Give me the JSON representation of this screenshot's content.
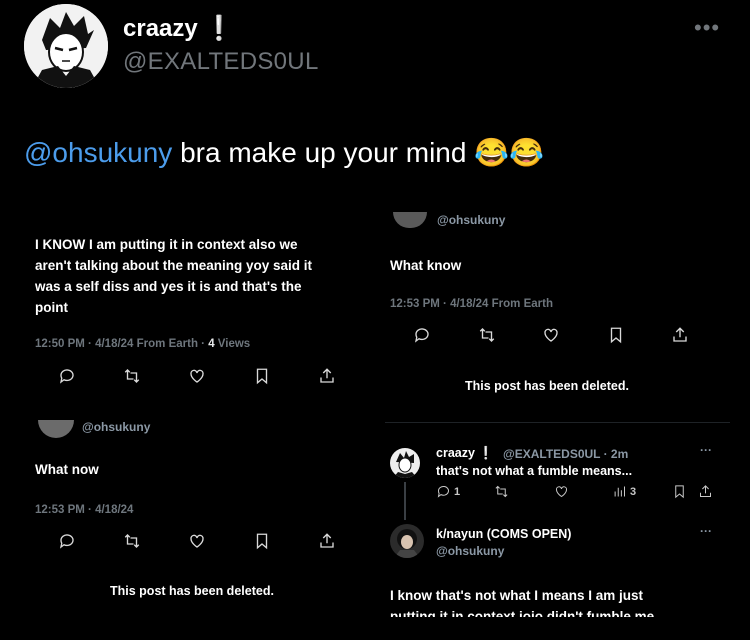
{
  "profile": {
    "name": "craazy",
    "badge": "❕",
    "handle": "@EXALTEDS0UL",
    "more_icon": "more-icon"
  },
  "tweet": {
    "mention": "@ohsukuny",
    "text": "bra make up your mind",
    "emoji": "😂😂"
  },
  "left": {
    "post1": {
      "text": "I KNOW I am putting it in context also we aren't talking about the meaning yoy said it was a self diss and yes it is and that's the point",
      "meta_prefix": "12:50 PM · 4/18/24 From Earth · ",
      "views_count": "4",
      "views_label": " Views"
    },
    "post2": {
      "handle": "@ohsukuny",
      "text": "What now",
      "meta": "12:53 PM · 4/18/24"
    },
    "deleted": "This post has been deleted."
  },
  "right": {
    "post1": {
      "handle": "@ohsukuny",
      "text": "What know",
      "meta": "12:53 PM · 4/18/24 From Earth"
    },
    "deleted": "This post has been deleted.",
    "reply1": {
      "name": "craazy",
      "badge": "❕",
      "handle_time": "@EXALTEDS0UL · 2m",
      "text": "that's not what a fumble means...",
      "reply_count": "1",
      "views_count": "3"
    },
    "reply2": {
      "name": "k/nayun (COMS OPEN)",
      "handle": "@ohsukuny",
      "text_line1": "I know that's not what I means I am just",
      "text_line2": "putting it in context jojo didn't fumble me"
    }
  }
}
